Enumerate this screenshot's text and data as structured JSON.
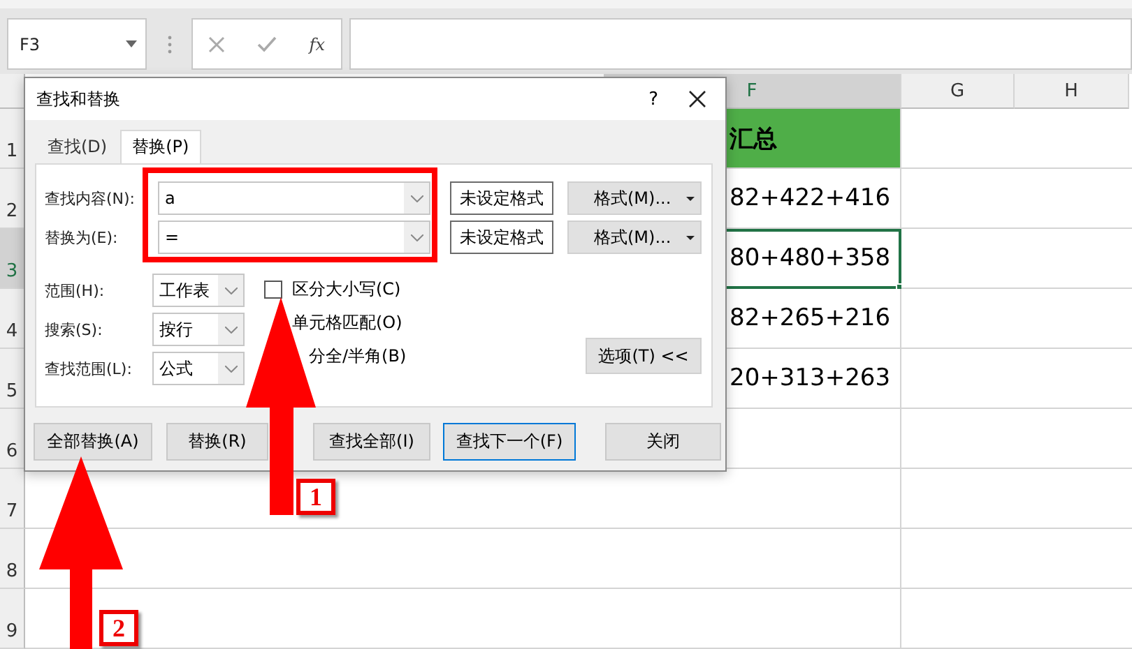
{
  "name_box": {
    "value": "F3"
  },
  "formula_bar": {
    "function_label": "fx"
  },
  "columns": [
    {
      "label": "F",
      "selected": true
    },
    {
      "label": "G",
      "selected": false
    },
    {
      "label": "H",
      "selected": false
    }
  ],
  "rows": [
    {
      "label": "1",
      "selected": false,
      "cells": [
        "汇总"
      ],
      "kind": "header"
    },
    {
      "label": "2",
      "selected": false,
      "cells": [
        "82+422+416"
      ],
      "kind": "data"
    },
    {
      "label": "3",
      "selected": true,
      "cells": [
        "80+480+358"
      ],
      "kind": "data"
    },
    {
      "label": "4",
      "selected": false,
      "cells": [
        "82+265+216"
      ],
      "kind": "data"
    },
    {
      "label": "5",
      "selected": false,
      "cells": [
        "20+313+263"
      ],
      "kind": "data"
    },
    {
      "label": "6",
      "selected": false,
      "cells": [],
      "kind": "data"
    },
    {
      "label": "7",
      "selected": false,
      "cells": [],
      "kind": "data"
    },
    {
      "label": "8",
      "selected": false,
      "cells": [],
      "kind": "data"
    },
    {
      "label": "9",
      "selected": false,
      "cells": [],
      "kind": "data"
    }
  ],
  "dialog": {
    "title": "查找和替换",
    "help": "?",
    "tabs": [
      {
        "label": "查找(D)",
        "selected": false
      },
      {
        "label": "替换(P)",
        "selected": true
      }
    ],
    "fields": [
      {
        "label": "查找内容(N):",
        "value": "a",
        "format": "未设定格式",
        "format_button": "格式(M)..."
      },
      {
        "label": "替换为(E):",
        "value": "=",
        "format": "未设定格式",
        "format_button": "格式(M)..."
      }
    ],
    "selects": [
      {
        "label": "范围(H):",
        "value": "工作表"
      },
      {
        "label": "搜索(S):",
        "value": "按行"
      },
      {
        "label": "查找范围(L):",
        "value": "公式"
      }
    ],
    "checkboxes": [
      {
        "label": "区分大小写(C)",
        "checked": false
      },
      {
        "label": "单元格匹配(O)"
      },
      {
        "label": "分全/半角(B)"
      }
    ],
    "options_button": "选项(T) <<",
    "buttons": [
      {
        "label": "全部替换(A)",
        "focused": false
      },
      {
        "label": "替换(R)",
        "focused": false
      },
      {
        "label": "查找全部(I)",
        "focused": false
      },
      {
        "label": "查找下一个(F)",
        "focused": true
      },
      {
        "label": "关闭",
        "focused": false
      }
    ]
  },
  "annotations": [
    {
      "label": "1"
    },
    {
      "label": "2"
    }
  ]
}
